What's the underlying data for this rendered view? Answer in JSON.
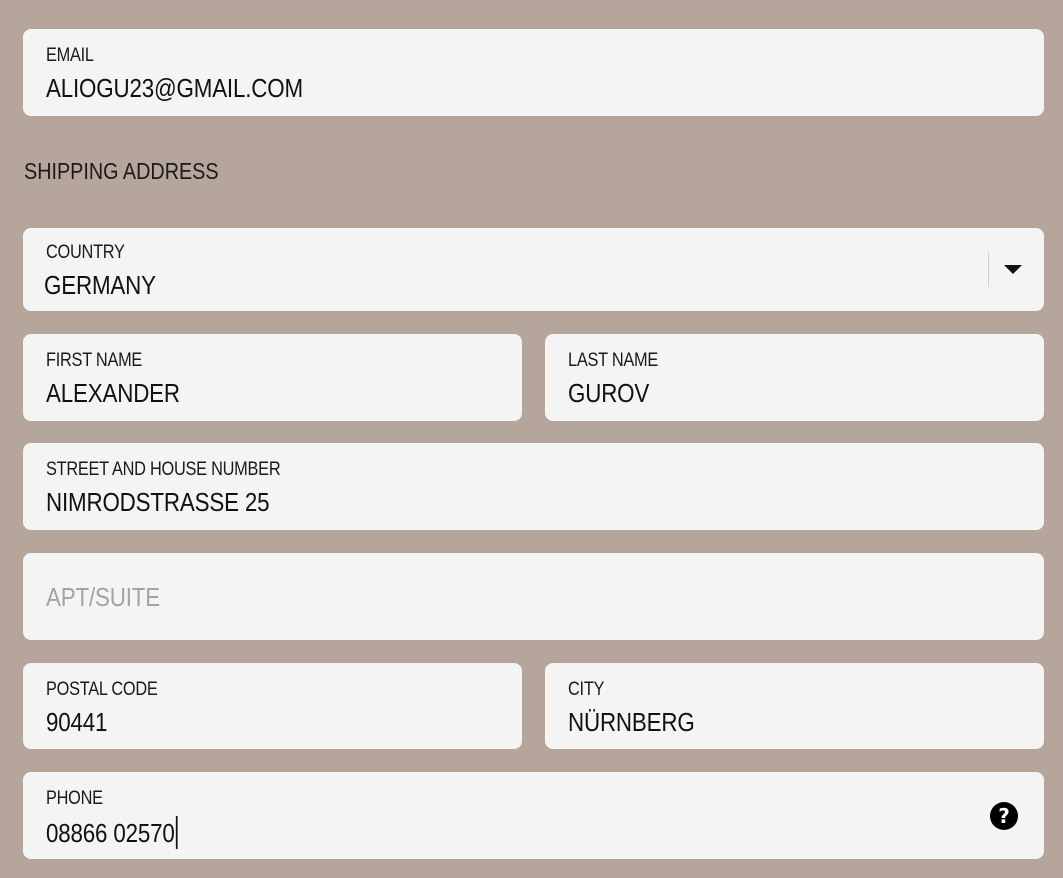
{
  "email": {
    "label": "EMAIL",
    "value": "ALIOGU23@GMAIL.COM"
  },
  "shipping": {
    "title": "SHIPPING ADDRESS",
    "country": {
      "label": "COUNTRY",
      "value": "GERMANY"
    },
    "first_name": {
      "label": "FIRST NAME",
      "value": "ALEXANDER"
    },
    "last_name": {
      "label": "LAST NAME",
      "value": "GUROV"
    },
    "street": {
      "label": "STREET AND HOUSE NUMBER",
      "value": "NIMRODSTRASSE 25"
    },
    "apt": {
      "placeholder": "APT/SUITE",
      "value": ""
    },
    "postal_code": {
      "label": "POSTAL CODE",
      "value": "90441"
    },
    "city": {
      "label": "CITY",
      "value": "NÜRNBERG"
    },
    "phone": {
      "label": "PHONE",
      "value": "08866 02570",
      "help_icon": "question-circle-icon",
      "help_glyph": "?"
    }
  },
  "colors": {
    "background": "#b5a59b",
    "field": "#f4f4f4",
    "text": "#1a1a1a",
    "placeholder": "#a3a3a3"
  },
  "icons": {
    "dropdown": "chevron-down-icon",
    "help": "question-circle-icon"
  }
}
